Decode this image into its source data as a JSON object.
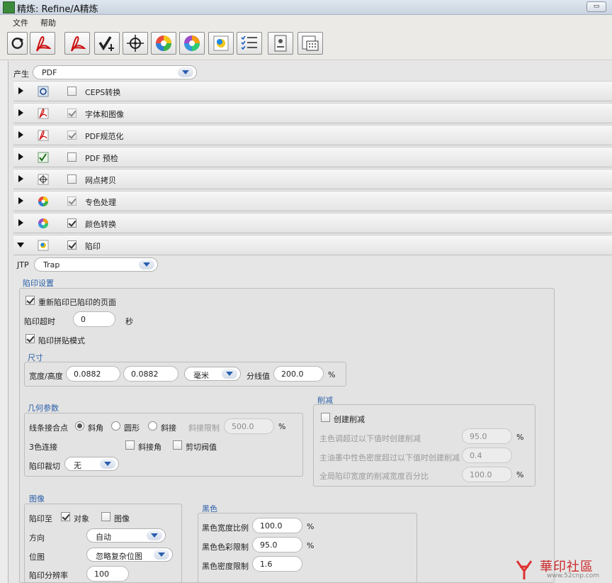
{
  "window": {
    "title": "精炼: Refine/A精炼",
    "restore_btn": "▭"
  },
  "menu": [
    "文件",
    "帮助"
  ],
  "toolbar": [
    {
      "icon": "refresh-icon"
    },
    {
      "icon": "pdf-icon"
    },
    {
      "icon": "pdf-normalize-icon"
    },
    {
      "icon": "preflight-icon"
    },
    {
      "icon": "crosshair-icon"
    },
    {
      "icon": "color-wheel-icon"
    },
    {
      "icon": "color-convert-icon"
    },
    {
      "icon": "trap-icon"
    },
    {
      "icon": "checklist-icon"
    },
    {
      "icon": "document-icon"
    },
    {
      "icon": "grid-icon"
    }
  ],
  "produce": {
    "label": "产生",
    "value": "PDF"
  },
  "steps": [
    {
      "label": "CEPS转换",
      "checked": false,
      "icon": "refresh-icon"
    },
    {
      "label": "字体和图像",
      "checked": true,
      "dim": true,
      "icon": "pdf-icon"
    },
    {
      "label": "PDF规范化",
      "checked": true,
      "dim": true,
      "icon": "pdf-icon"
    },
    {
      "label": "PDF 预检",
      "checked": false,
      "icon": "preflight-icon"
    },
    {
      "label": "网点拷贝",
      "checked": false,
      "icon": "crosshair-icon"
    },
    {
      "label": "专色处理",
      "checked": true,
      "dim": true,
      "icon": "color-wheel-icon"
    },
    {
      "label": "颜色转换",
      "checked": true,
      "icon": "color-wheel-icon"
    },
    {
      "label": "陷印",
      "checked": true,
      "open": true,
      "icon": "trap-icon"
    }
  ],
  "jtp": {
    "label": "JTP",
    "value": "Trap"
  },
  "trap": {
    "title": "陷印设置",
    "retrap_label": "重新陷印已陷印的页面",
    "timeout_label": "陷印超时",
    "timeout_value": "0",
    "timeout_unit": "秒",
    "tile_label": "陷印拼贴模式",
    "size": {
      "title": "尺寸",
      "label": "宽度/高度",
      "width": "0.0882",
      "height": "0.0882",
      "unit": "毫米",
      "split_label": "分线值",
      "split_value": "200.0",
      "split_unit": "%"
    },
    "geometry": {
      "title": "几何参数",
      "join_label": "线条接合点",
      "miter": "斜角",
      "round": "圆形",
      "bevel": "斜接",
      "miter_limit_label": "斜接限制",
      "miter_limit_value": "500.0",
      "miter_limit_unit": "%",
      "three_color_label": "3色连接",
      "bevel_join": "斜接角",
      "clip_threshold": "剪切阀值",
      "trap_clip_label": "陷印裁切",
      "trap_clip_value": "无"
    },
    "reduce": {
      "title": "削减",
      "create_label": "创建削减",
      "row1_label": "主色调超过以下值时创建削减",
      "row1_value": "95.0",
      "row1_unit": "%",
      "row2_label": "主油墨中性色密度超过以下值时创建削减",
      "row2_value": "0.4",
      "row3_label": "全局陷印宽度的削减宽度百分比",
      "row3_value": "100.0",
      "row3_unit": "%"
    },
    "image": {
      "title": "图像",
      "trap_to_label": "陷印至",
      "object": "对象",
      "image": "图像",
      "direction_label": "方向",
      "direction_value": "自动",
      "bitmap_label": "位图",
      "bitmap_value": "忽略复杂位图",
      "resolution_label": "陷印分辨率",
      "resolution_value": "100"
    },
    "black": {
      "title": "黑色",
      "width_ratio_label": "黑色宽度比例",
      "width_ratio_value": "100.0",
      "width_ratio_unit": "%",
      "color_limit_label": "黑色色彩限制",
      "color_limit_value": "95.0",
      "color_limit_unit": "%",
      "density_label": "黑色密度限制",
      "density_value": "1.6"
    }
  },
  "watermark": {
    "text": "華印社區",
    "url": "www.52cnp.com"
  },
  "colors": {
    "accent": "#2b5fa8",
    "titlebar": "#c9d3df"
  }
}
